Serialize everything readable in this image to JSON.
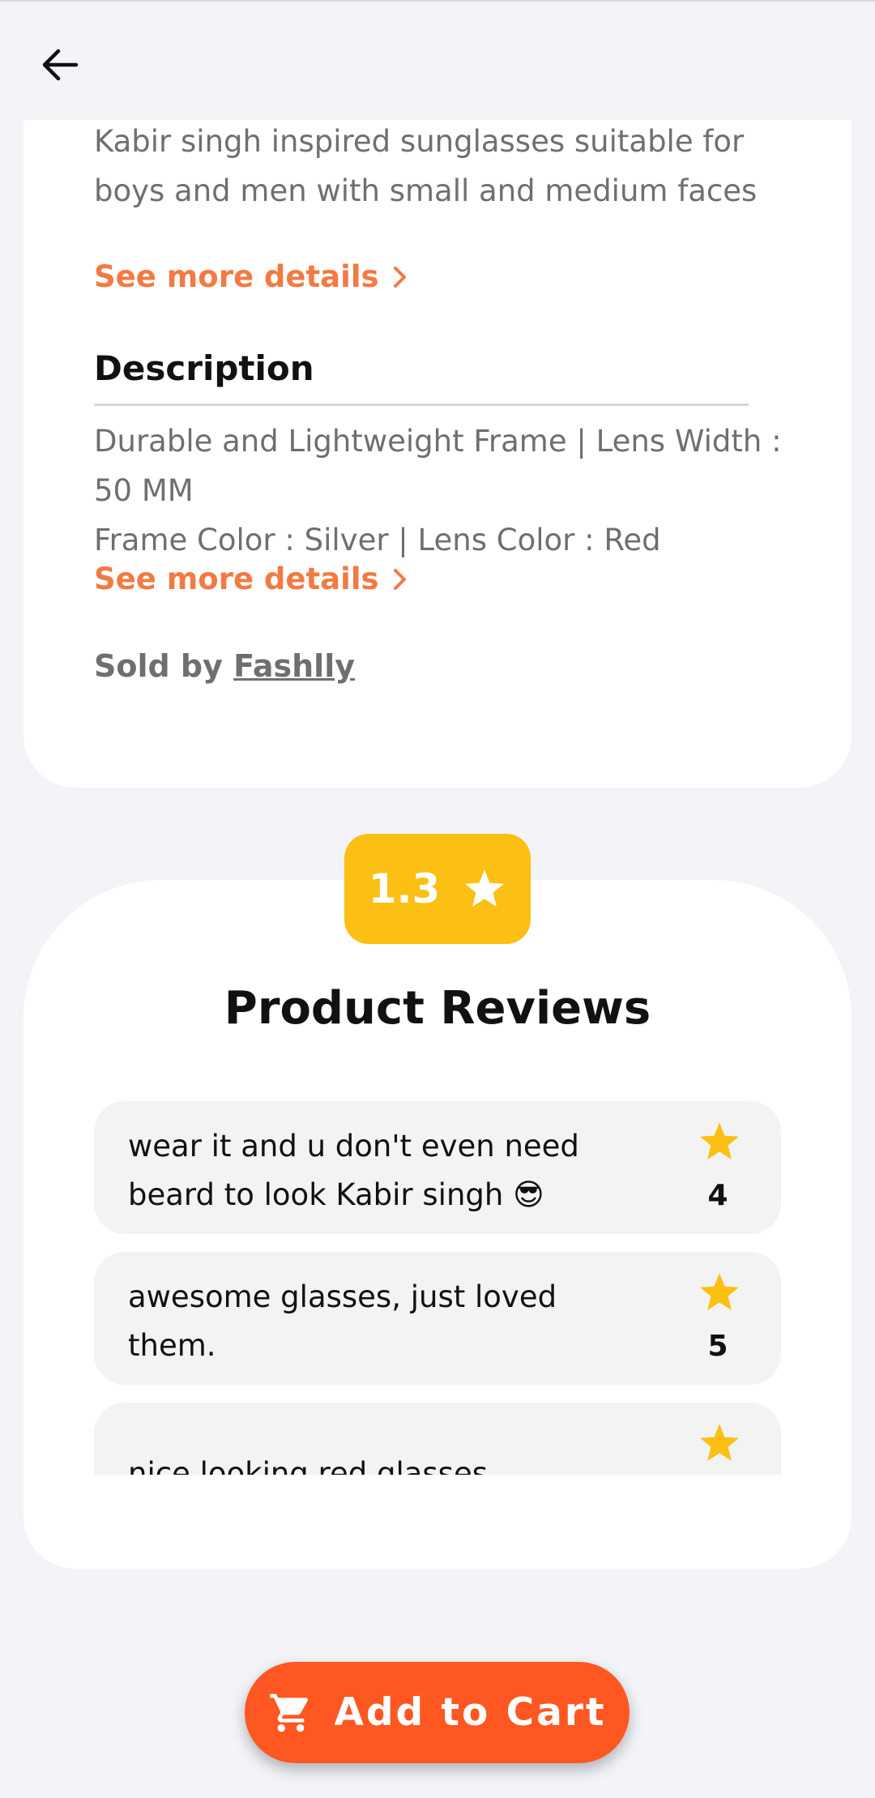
{
  "product": {
    "short_description": "Kabir singh inspired sunglasses suitable for boys and men with small and medium faces",
    "see_more_label": "See more details",
    "description_heading": "Description",
    "description_line1": "Durable and Lightweight Frame | Lens Width : 50 MM",
    "description_line2": "Frame Color : Silver | Lens Color : Red",
    "sold_by_label": "Sold by",
    "seller_name": "Fashlly"
  },
  "reviews": {
    "average_rating": "1.3",
    "title": "Product Reviews",
    "items": [
      {
        "text": "wear it and u don't even need beard to look Kabir singh 😎",
        "rating": "4"
      },
      {
        "text": "awesome glasses, just loved them.",
        "rating": "5"
      },
      {
        "text": "nice looking red glasses",
        "rating": ""
      }
    ]
  },
  "actions": {
    "add_to_cart_label": "Add to Cart"
  },
  "colors": {
    "accent_orange": "#f27a43",
    "cart_button": "#fe5721",
    "star_yellow": "#fcbf13"
  },
  "icons": [
    "arrow-left-icon",
    "chevron-right-icon",
    "star-icon",
    "shopping-cart-icon"
  ]
}
